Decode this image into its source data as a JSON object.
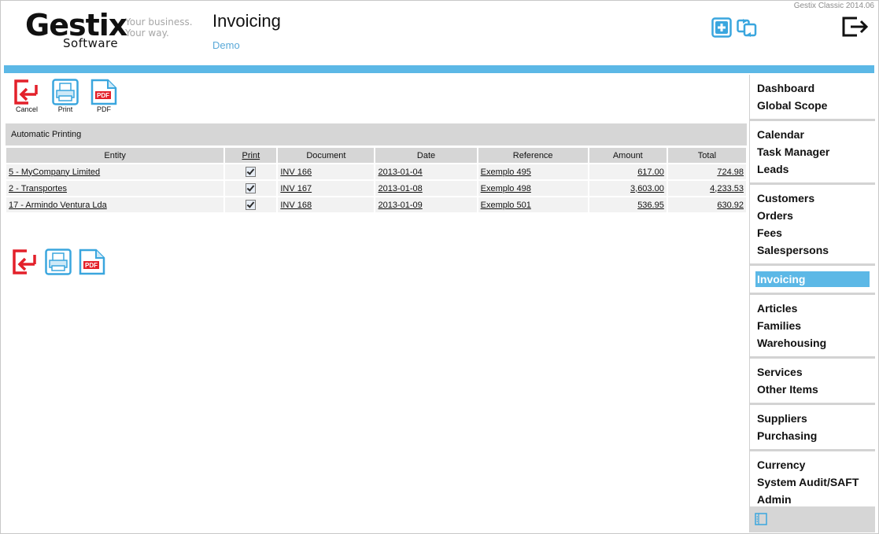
{
  "app": {
    "logo_main": "Gestix",
    "logo_sub": "Software",
    "tagline_line1": "Your business.",
    "tagline_line2": "Your way.",
    "version": "Gestix Classic 2014.06"
  },
  "page": {
    "title": "Invoicing",
    "subtitle": "Demo"
  },
  "colors": {
    "accent": "#5cb8e6",
    "cancel_red": "#e3202a",
    "header_gray": "#d6d6d6"
  },
  "toolbar": {
    "cancel_label": "Cancel",
    "print_label": "Print",
    "pdf_label": "PDF",
    "pdf_badge": "PDF"
  },
  "section": {
    "title": "Automatic Printing"
  },
  "table": {
    "columns": [
      "Entity",
      "Print",
      "Document",
      "Date",
      "Reference",
      "Amount",
      "Total"
    ],
    "rows": [
      {
        "entity": "5 - MyCompany Limited",
        "print": true,
        "document": "INV 166",
        "date": "2013-01-04",
        "reference": "Exemplo 495",
        "amount": "617.00",
        "total": "724.98"
      },
      {
        "entity": "2 - Transportes",
        "print": true,
        "document": "INV 167",
        "date": "2013-01-08",
        "reference": "Exemplo 498",
        "amount": "3,603.00",
        "total": "4,233.53"
      },
      {
        "entity": "17 - Armindo Ventura Lda",
        "print": true,
        "document": "INV 168",
        "date": "2013-01-09",
        "reference": "Exemplo 501",
        "amount": "536.95",
        "total": "630.92"
      }
    ]
  },
  "sidebar": {
    "groups": [
      [
        "Dashboard",
        "Global Scope"
      ],
      [
        "Calendar",
        "Task Manager",
        "Leads"
      ],
      [
        "Customers",
        "Orders",
        "Fees",
        "Salespersons"
      ],
      [
        "Invoicing"
      ],
      [
        "Articles",
        "Families",
        "Warehousing"
      ],
      [
        "Services",
        "Other Items"
      ],
      [
        "Suppliers",
        "Purchasing"
      ],
      [
        "Currency",
        "System Audit/SAFT",
        "Admin"
      ]
    ],
    "active": "Invoicing"
  },
  "icons": {
    "new": "plus-square-icon",
    "refresh": "refresh-icon",
    "logout": "logout-icon",
    "cancel": "back-arrow-icon",
    "print": "printer-icon",
    "pdf": "pdf-file-icon",
    "sidebar_footer": "panel-toggle-icon"
  }
}
